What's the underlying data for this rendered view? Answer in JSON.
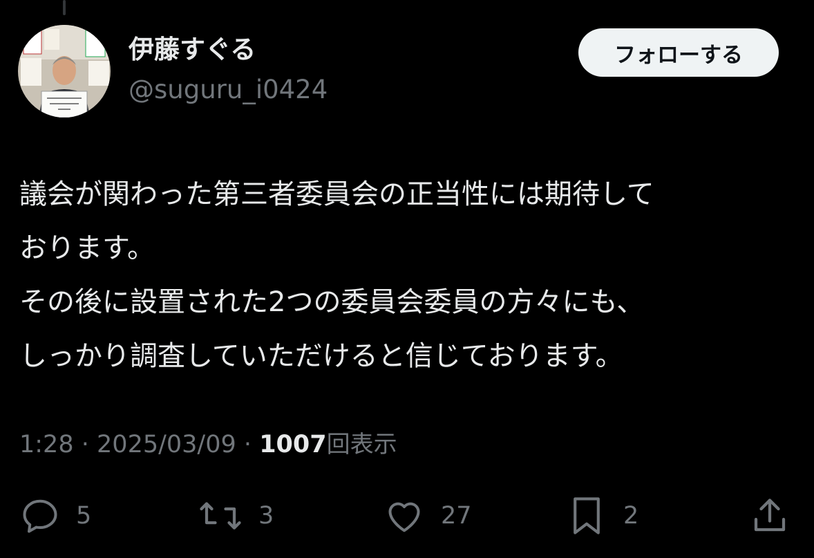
{
  "author": {
    "name": "伊藤すぐる",
    "handle": "@suguru_i0424"
  },
  "follow_label": "フォローする",
  "tweet": {
    "lines": [
      "議会が関わった第三者委員会の正当性には期待して",
      "おります。",
      "その後に設置された2つの委員会委員の方々にも、",
      "しっかり調査していただけると信じております。"
    ]
  },
  "meta": {
    "time": "1:28",
    "separator": "·",
    "date": "2025/03/09",
    "views_count": "1007",
    "views_label": "回表示"
  },
  "actions": {
    "reply_count": "5",
    "retweet_count": "3",
    "like_count": "27",
    "bookmark_count": "2"
  },
  "icons": {
    "reply": "reply-icon",
    "retweet": "retweet-icon",
    "like": "heart-icon",
    "bookmark": "bookmark-icon",
    "share": "share-icon"
  },
  "colors": {
    "background": "#000000",
    "primary_text": "#e7e9ea",
    "secondary_text": "#71767b",
    "follow_button_bg": "#eff3f4",
    "follow_button_text": "#0f1419"
  }
}
